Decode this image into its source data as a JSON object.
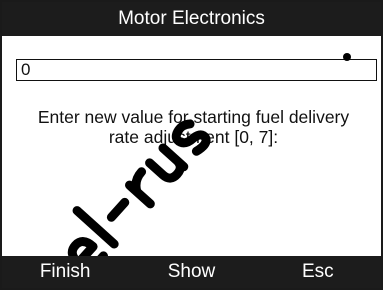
{
  "header": {
    "title": "Motor Electronics"
  },
  "input": {
    "value": "0"
  },
  "prompt": {
    "text": "Enter new value for starting fuel delivery\nrate adjustment [0, 7]:"
  },
  "watermark": {
    "text": "Del-rus",
    "color": "#000000"
  },
  "softkeys": [
    {
      "label": "Finish"
    },
    {
      "label": "Show"
    },
    {
      "label": "Esc"
    }
  ],
  "colors": {
    "bar_background": "#1c1c1c",
    "bar_text": "#ffffff",
    "screen_background": "#ffffff",
    "text": "#111111"
  }
}
